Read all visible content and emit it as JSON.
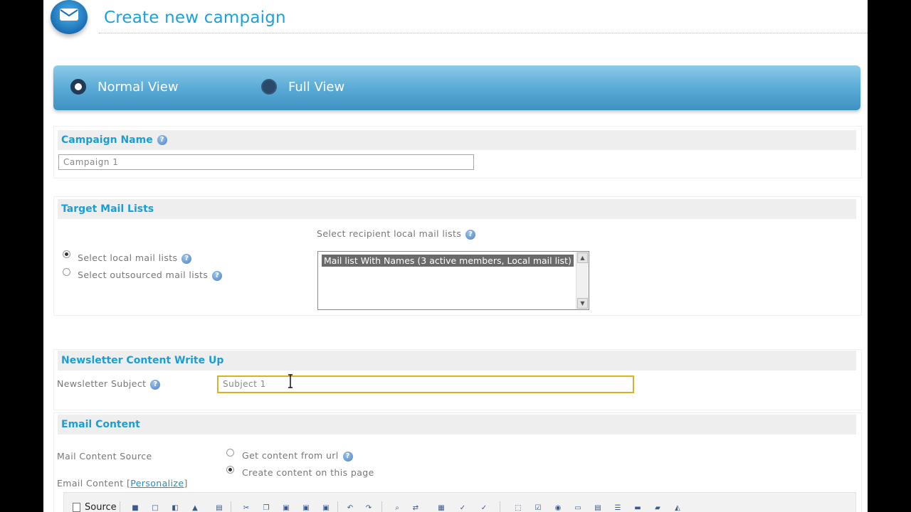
{
  "header": {
    "title": "Create new campaign",
    "logo": "envelope-icon"
  },
  "views": [
    {
      "label": "Normal View",
      "selected": true
    },
    {
      "label": "Full View",
      "selected": false
    }
  ],
  "campaign_name": {
    "heading": "Campaign Name",
    "value": "Campaign 1"
  },
  "target_lists": {
    "heading": "Target Mail Lists",
    "recipient_label": "Select recipient local mail lists",
    "options": [
      {
        "label": "Select local mail lists",
        "selected": true
      },
      {
        "label": "Select outsourced mail lists",
        "selected": false
      }
    ],
    "list_items": [
      "Mail list With Names (3 active members, Local mail list)"
    ]
  },
  "newsletter": {
    "heading": "Newsletter Content Write Up",
    "subject_label": "Newsletter Subject",
    "subject_value": "Subject 1"
  },
  "email_content": {
    "heading": "Email Content",
    "source_label": "Mail Content Source",
    "source_options": [
      {
        "label": "Get content from url",
        "selected": false
      },
      {
        "label": "Create content on this page",
        "selected": true
      }
    ],
    "content_label": "Email Content [",
    "personalize_link": "Personalize",
    "content_label_end": "]"
  },
  "editor_toolbar": {
    "source_label": "Source",
    "icons": [
      "save-icon",
      "new-page-icon",
      "preview-icon",
      "print-icon",
      "templates-icon",
      "cut-icon",
      "copy-icon",
      "paste-icon",
      "paste-text-icon",
      "paste-word-icon",
      "undo-icon",
      "redo-icon",
      "find-icon",
      "replace-icon",
      "select-all-icon",
      "spellcheck-icon",
      "scayt-icon",
      "form-icon",
      "checkbox-icon",
      "radio-icon",
      "textfield-icon",
      "textarea-icon",
      "select-icon",
      "button-icon",
      "image-button-icon",
      "hidden-field-icon"
    ]
  },
  "colors": {
    "accent": "#1ba2d8",
    "subject_border": "#d8b12e",
    "view_bar": "#5aabd6"
  }
}
